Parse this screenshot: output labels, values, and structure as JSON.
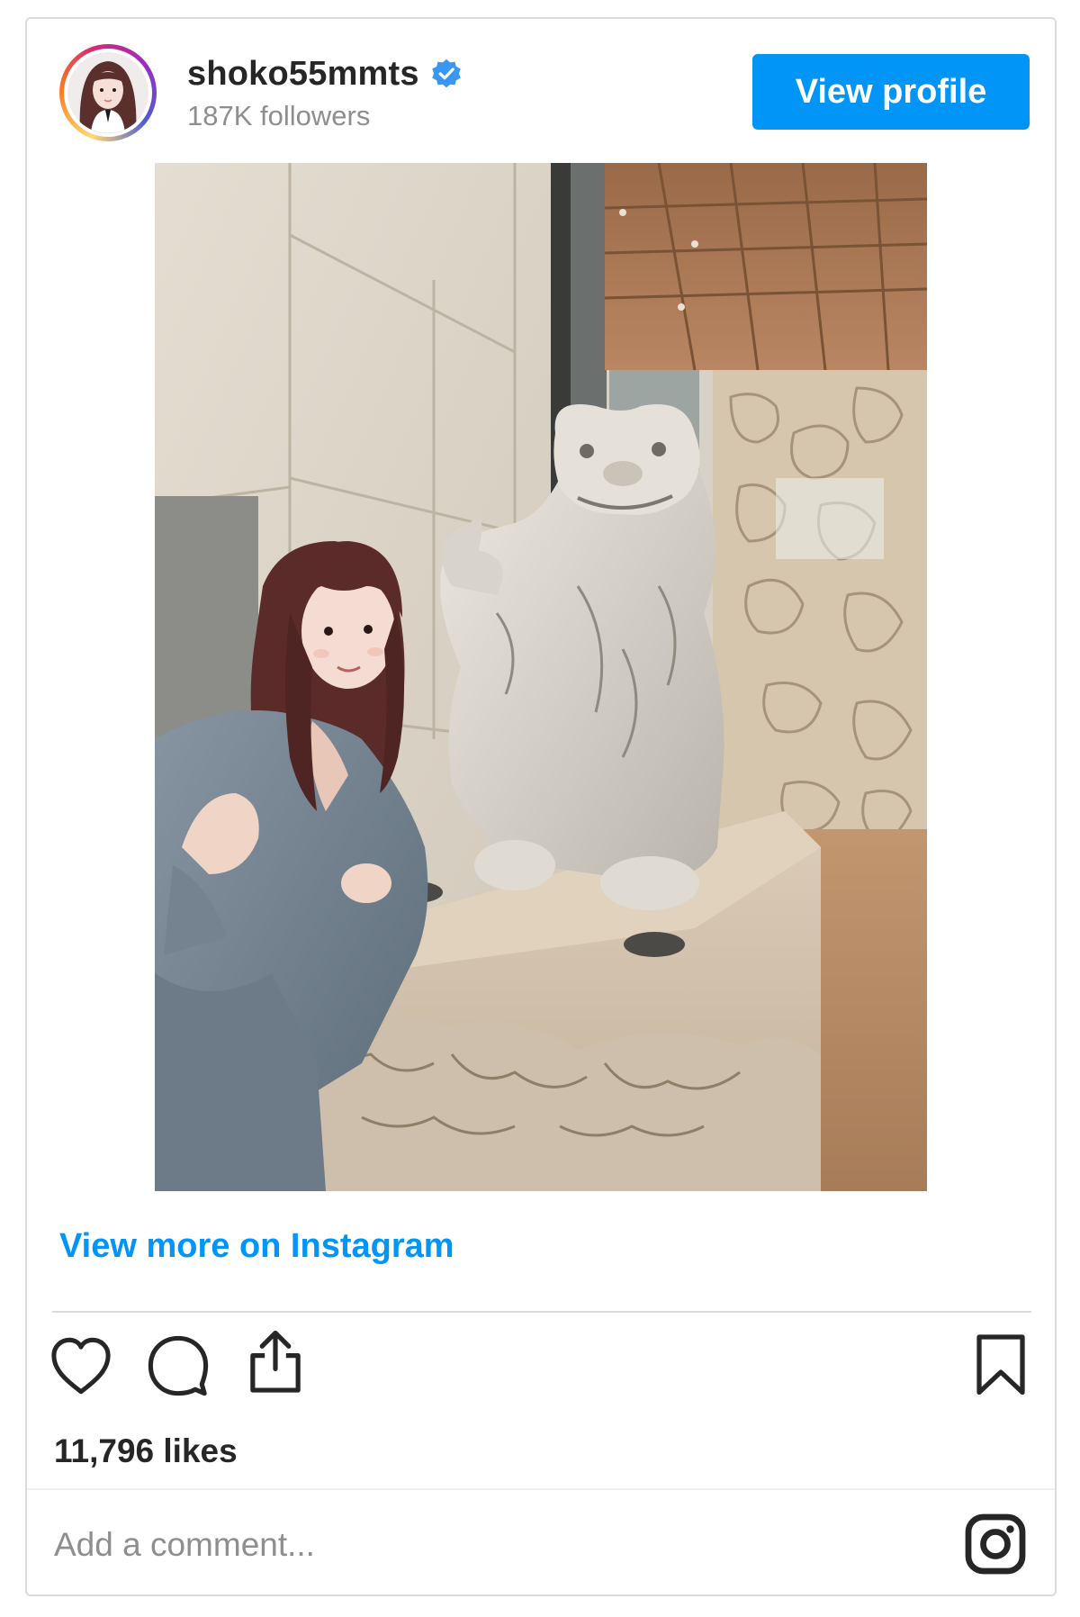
{
  "profile": {
    "username": "shoko55mmts",
    "verified": true,
    "followers": "187K followers",
    "view_profile_label": "View profile"
  },
  "post": {
    "image_alt": "Woman in a grey fleece robe posing beside a white shisa lion-dog statue on a coral stone pedestal"
  },
  "links": {
    "view_more_label": "View more on Instagram"
  },
  "engagement": {
    "likes": "11,796 likes"
  },
  "comment": {
    "placeholder": "Add a comment..."
  },
  "icons": {
    "like": "heart-icon",
    "comment": "comment-icon",
    "share": "share-icon",
    "save": "bookmark-icon",
    "brand": "instagram-logo-icon",
    "verified": "verified-badge-icon"
  },
  "colors": {
    "accent": "#0095f6",
    "text": "#262626",
    "muted": "#8e8e8e",
    "border": "#dbdbdb"
  }
}
